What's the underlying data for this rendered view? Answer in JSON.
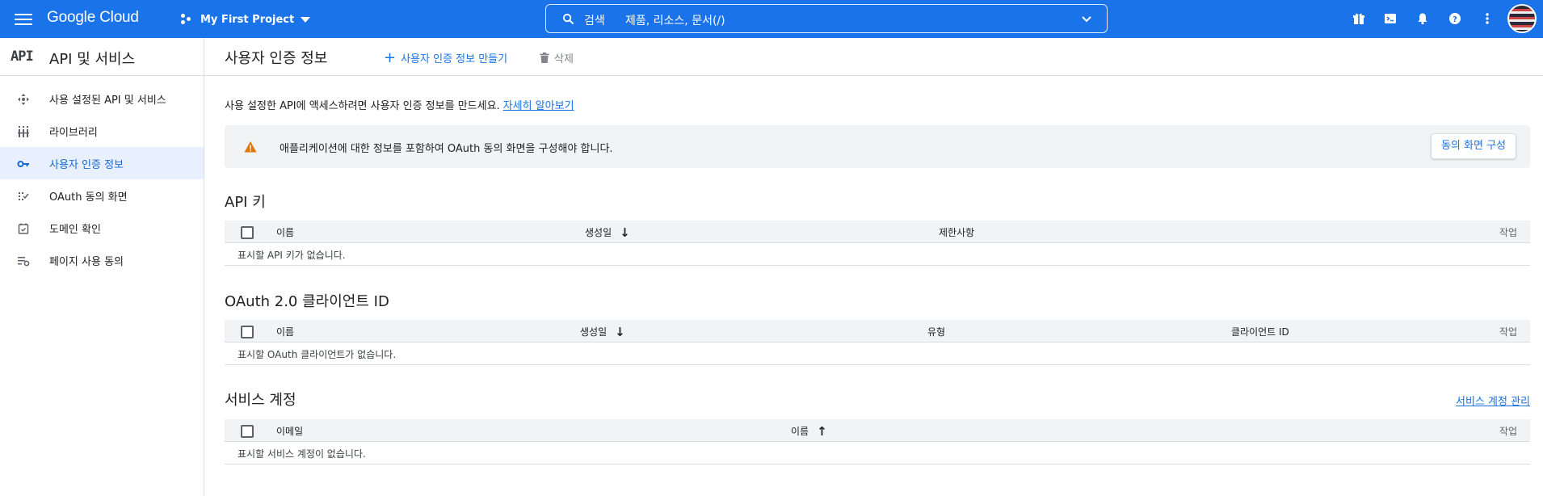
{
  "topbar": {
    "brand": "Google Cloud",
    "project": "My First Project",
    "search_label": "검색",
    "search_placeholder": "제품, 리소스, 문서(/)",
    "icons": [
      "gift-icon",
      "terminal-icon",
      "bell-icon",
      "help-icon",
      "more-vert-icon"
    ],
    "color": "#1a73e8"
  },
  "sidebar": {
    "logo": "API",
    "title": "API 및 서비스",
    "items": [
      {
        "label": "사용 설정된 API 및 서비스",
        "icon": "enabled-apis-icon"
      },
      {
        "label": "라이브러리",
        "icon": "library-icon"
      },
      {
        "label": "사용자 인증 정보",
        "icon": "key-icon",
        "active": true
      },
      {
        "label": "OAuth 동의 화면",
        "icon": "oauth-icon"
      },
      {
        "label": "도메인 확인",
        "icon": "domain-check-icon"
      },
      {
        "label": "페이지 사용 동의",
        "icon": "page-usage-icon"
      }
    ]
  },
  "header": {
    "title": "사용자 인증 정보",
    "create_label": "사용자 인증 정보 만들기",
    "delete_label": "삭제"
  },
  "intro": {
    "text": "사용 설정한 API에 액세스하려면 사용자 인증 정보를 만드세요.",
    "link": "자세히 알아보기"
  },
  "banner": {
    "text": "애플리케이션에 대한 정보를 포함하여 OAuth 동의 화면을 구성해야 합니다.",
    "button": "동의 화면 구성"
  },
  "api_keys": {
    "title": "API 키",
    "columns": [
      "이름",
      "생성일",
      "제한사항",
      "작업"
    ],
    "empty": "표시할 API 키가 없습니다."
  },
  "oauth": {
    "title": "OAuth 2.0 클라이언트 ID",
    "columns": [
      "이름",
      "생성일",
      "유형",
      "클라이언트 ID",
      "작업"
    ],
    "empty": "표시할 OAuth 클라이언트가 없습니다."
  },
  "service_accounts": {
    "title": "서비스 계정",
    "manage_link": "서비스 계정 관리",
    "columns": [
      "이메일",
      "이름",
      "작업"
    ],
    "empty": "표시할 서비스 계정이 없습니다."
  }
}
